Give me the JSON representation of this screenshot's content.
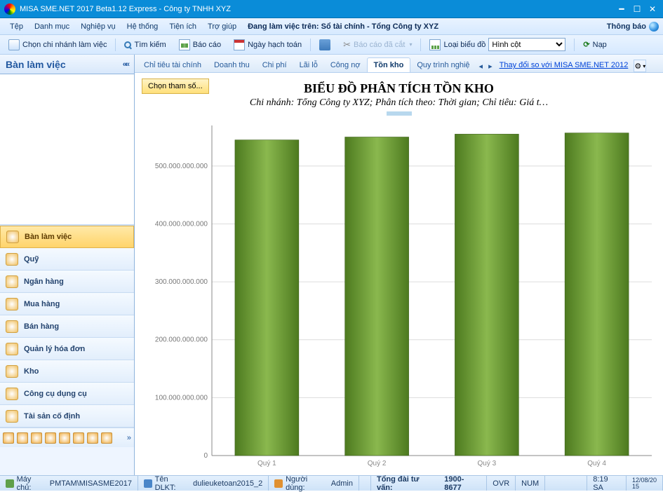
{
  "window": {
    "title": "MISA SME.NET 2017 Beta1.12  Express - Công ty TNHH XYZ"
  },
  "menus": {
    "items": [
      "Tệp",
      "Danh mục",
      "Nghiệp vụ",
      "Hệ thống",
      "Tiện ích",
      "Trợ giúp"
    ],
    "working_on_label": "Đang làm việc trên:",
    "working_on_value": "Sổ tài chính - Tổng Công ty XYZ",
    "notify_label": "Thông báo"
  },
  "toolbar": {
    "branch": "Chọn chi nhánh làm việc",
    "search": "Tìm kiếm",
    "report": "Báo cáo",
    "date": "Ngày hạch toán",
    "cut_report": "Báo cáo đã cắt",
    "chart_type_label": "Loại biểu đồ",
    "chart_type_value": "Hình cột",
    "reload": "Nạp"
  },
  "sidebar": {
    "title": "Bàn làm việc",
    "items": [
      {
        "label": "Bàn làm việc",
        "active": true
      },
      {
        "label": "Quỹ"
      },
      {
        "label": "Ngân hàng"
      },
      {
        "label": "Mua hàng"
      },
      {
        "label": "Bán hàng"
      },
      {
        "label": "Quản lý hóa đơn"
      },
      {
        "label": "Kho"
      },
      {
        "label": "Công cụ dụng cụ"
      },
      {
        "label": "Tài sản cố định"
      }
    ]
  },
  "tabs": {
    "items": [
      "Chỉ tiêu tài chính",
      "Doanh thu",
      "Chi phí",
      "Lãi lỗ",
      "Công nợ",
      "Tồn kho",
      "Quy trình nghiệ"
    ],
    "active_index": 5,
    "link_label": "Thay đổi so với MISA SME.NET 2012"
  },
  "main": {
    "param_button": "Chọn tham số...",
    "chart_title": "BIỂU ĐỒ PHÂN TÍCH TỒN KHO",
    "chart_subtitle": "Chi nhánh: Tổng Công ty XYZ; Phân tích theo: Thời gian; Chỉ tiêu: Giá t…"
  },
  "chart_data": {
    "type": "bar",
    "categories": [
      "Quý 1",
      "Quý 2",
      "Quý 3",
      "Quý 4"
    ],
    "values": [
      545000000000,
      550000000000,
      555000000000,
      557000000000
    ],
    "y_ticks": [
      0,
      100000000000,
      200000000000,
      300000000000,
      400000000000,
      500000000000
    ],
    "y_tick_labels": [
      "0",
      "100.000.000.000",
      "200.000.000.000",
      "300.000.000.000",
      "400.000.000.000",
      "500.000.000.000"
    ],
    "ylim": [
      0,
      570000000000
    ],
    "title": "BIỂU ĐỒ PHÂN TÍCH TỒN KHO",
    "subtitle": "Chi nhánh: Tổng Công ty XYZ; Phân tích theo: Thời gian; Chỉ tiêu: Giá t…",
    "xlabel": "",
    "ylabel": ""
  },
  "statusbar": {
    "host_label": "Máy chủ:",
    "host_value": "PMTAM\\MISASME2017",
    "db_label": "Tên DLKT:",
    "db_value": "dulieuketoan2015_2",
    "user_label": "Người dùng:",
    "user_value": "Admin",
    "hotline_label": "Tổng đài tư vấn:",
    "hotline_value": "1900-8677",
    "ovr": "OVR",
    "num": "NUM",
    "time": "8:19 SA",
    "date": "12/08/20\n15"
  }
}
